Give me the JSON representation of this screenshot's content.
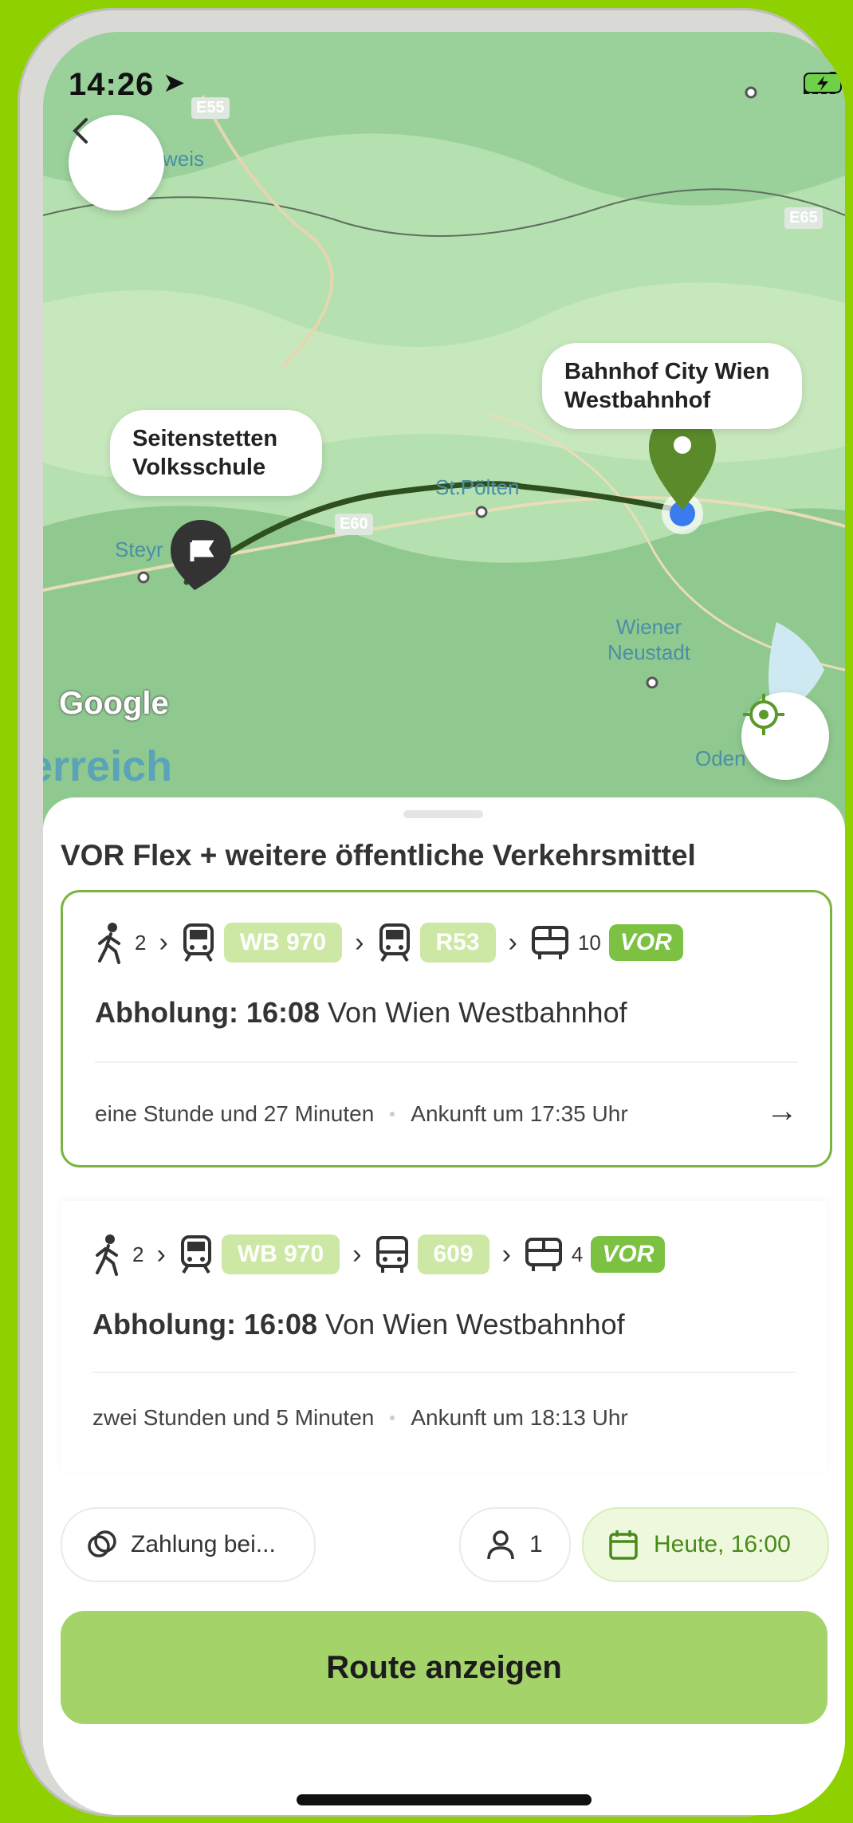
{
  "status": {
    "time": "14:26"
  },
  "map": {
    "labels": {
      "destination": "Bahnhof City Wien Westbahnhof",
      "origin": "Seitenstetten Volksschule",
      "st_poelten": "St.Pölten",
      "steyr": "Steyr",
      "wiener_neustadt": "Wiener Neustadt",
      "oden": "Oden",
      "weis": "weis",
      "country": "erreich",
      "google": "Google",
      "road_e55": "E55",
      "road_e65": "E65",
      "road_e60": "E60"
    }
  },
  "sheet": {
    "title": "VOR Flex + weitere öffentliche Verkehrsmittel",
    "routes": [
      {
        "walk_minutes": "2",
        "leg1": "WB 970",
        "leg2": "R53",
        "flex_minutes": "10",
        "flex_brand": "VOR",
        "pickup_label": "Abholung: 16:08",
        "pickup_from": "Von Wien Westbahnhof",
        "duration": "eine Stunde und 27 Minuten",
        "arrival": "Ankunft um 17:35 Uhr",
        "selected": true
      },
      {
        "walk_minutes": "2",
        "leg1": "WB 970",
        "leg2": "609",
        "flex_minutes": "4",
        "flex_brand": "VOR",
        "pickup_label": "Abholung: 16:08",
        "pickup_from": "Von Wien Westbahnhof",
        "duration": "zwei Stunden und 5 Minuten",
        "arrival": "Ankunft um 18:13 Uhr",
        "selected": false
      }
    ]
  },
  "controls": {
    "payment": "Zahlung bei...",
    "passengers": "1",
    "datetime": "Heute, 16:00",
    "cta": "Route anzeigen"
  },
  "colors": {
    "accent": "#7cb342",
    "cta": "#a4d36a",
    "chip": "#cde8a4",
    "pin": "#5a8a2a",
    "user": "#3a7bf0"
  }
}
